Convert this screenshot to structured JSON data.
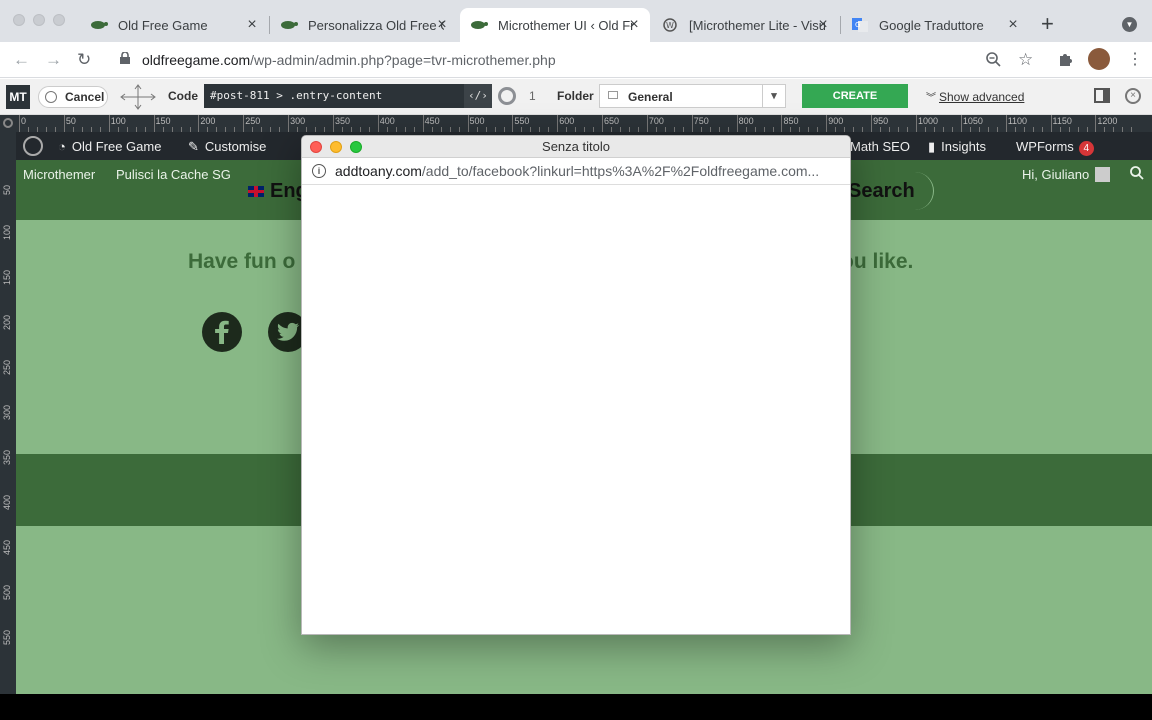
{
  "browser": {
    "tabs": [
      {
        "label": "Old Free Game",
        "icon": "turtle-icon"
      },
      {
        "label": "Personalizza Old Free Game",
        "icon": "turtle-icon"
      },
      {
        "label": "Microthemer UI ‹ Old Free Game",
        "icon": "turtle-icon",
        "active": true
      },
      {
        "label": "[Microthemer Lite - Visual Editor",
        "icon": "wordpress-icon"
      },
      {
        "label": "Google Traduttore",
        "icon": "google-translate-icon"
      }
    ],
    "url_domain": "oldfreegame.com",
    "url_path": "/wp-admin/admin.php?page=tvr-microthemer.php"
  },
  "microthemer": {
    "logo": "MT",
    "cancel_label": "Cancel",
    "code_label": "Code",
    "selector_value": "#post-811 > .entry-content",
    "selector_count": "1",
    "folder_label": "Folder",
    "folder_value": "General",
    "create_selector_label": "CREATE SELECTOR",
    "show_advanced_label": "Show advanced"
  },
  "ruler": {
    "h_labels": [
      "0",
      "50",
      "100",
      "150",
      "200",
      "250",
      "300",
      "350",
      "400",
      "450",
      "500",
      "550",
      "600",
      "650",
      "700",
      "750",
      "800",
      "850",
      "900",
      "950",
      "1000",
      "1050",
      "1100",
      "1150",
      "1200"
    ],
    "v_labels": [
      "50",
      "100",
      "150",
      "200",
      "250",
      "300",
      "350",
      "400",
      "450",
      "500",
      "550"
    ]
  },
  "wp_admin_bar": {
    "site_name": "Old Free Game",
    "customise": "Customise",
    "rank_math": "Math SEO",
    "insights": "Insights",
    "wpforms": "WPForms",
    "wpforms_count": "4"
  },
  "site": {
    "microthemer_link": "Microthemer",
    "cache_link": "Pulisci la Cache SG",
    "language": "Eng",
    "search_label": "Search",
    "greeting": "Hi, Giuliano",
    "tagline_left": "Have fun o",
    "tagline_right": "ou like."
  },
  "popup": {
    "title": "Senza titolo",
    "url_domain": "addtoany.com",
    "url_path": "/add_to/facebook?linkurl=https%3A%2F%2Foldfreegame.com..."
  }
}
